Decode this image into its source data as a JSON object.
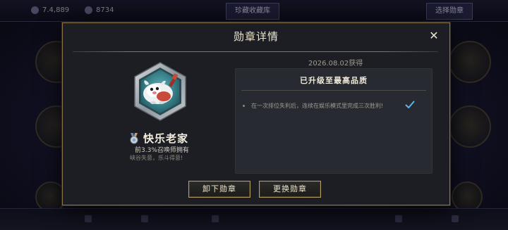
{
  "background": {
    "currency_1": "7.4,889",
    "currency_2": "8734",
    "tab_1": "珍藏收藏库",
    "tab_2": "选择勋章",
    "bottom_items": [
      "",
      "",
      "",
      "",
      ""
    ],
    "side_text": ""
  },
  "modal": {
    "title": "勋章详情",
    "close_label": "✕",
    "obtained_date": "2026.08.02获得",
    "badge": {
      "name": "快乐老家",
      "rarity": "前3.3%召唤师拥有",
      "motto": "峡谷失意，乐斗得意!"
    },
    "quality_panel": {
      "heading": "已升级至最高品质",
      "conditions": [
        {
          "text": "在一次排位失利后，连续在娱乐模式里完成三次胜利!",
          "completed": true
        }
      ]
    },
    "buttons": {
      "remove": "卸下勋章",
      "replace": "更换勋章"
    }
  },
  "colors": {
    "modal_border": "#8b7547",
    "accent_gold": "#b79f62",
    "check_blue": "#5fb6f2",
    "badge_teal": "#3f8f97"
  },
  "icons": {
    "close": "close-icon",
    "medal": "medal-icon",
    "check": "check-icon",
    "badge": "poro-badge-icon"
  }
}
